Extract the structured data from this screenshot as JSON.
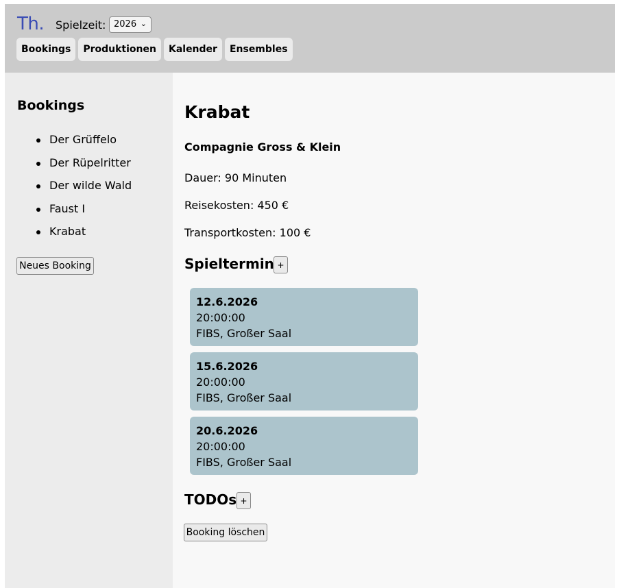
{
  "header": {
    "logo": "Th.",
    "season_label": "Spielzeit:",
    "season_value": "2026",
    "nav": [
      "Bookings",
      "Produktionen",
      "Kalender",
      "Ensembles"
    ]
  },
  "sidebar": {
    "title": "Bookings",
    "items": [
      "Der Grüffelo",
      "Der Rüpelritter",
      "Der wilde Wald",
      "Faust I",
      "Krabat"
    ],
    "new_button": "Neues Booking"
  },
  "main": {
    "title": "Krabat",
    "company": "Compagnie Gross & Klein",
    "duration": "Dauer: 90 Minuten",
    "travel_costs": "Reisekosten: 450 €",
    "transport_costs": "Transportkosten: 100 €",
    "dates_title": "Spieltermine",
    "add_label": "+",
    "dates": [
      {
        "date": "12.6.2026",
        "time": "20:00:00",
        "venue": "FIBS, Großer Saal"
      },
      {
        "date": "15.6.2026",
        "time": "20:00:00",
        "venue": "FIBS, Großer Saal"
      },
      {
        "date": "20.6.2026",
        "time": "20:00:00",
        "venue": "FIBS, Großer Saal"
      }
    ],
    "todos_title": "TODOs",
    "delete_button": "Booking löschen"
  },
  "colors": {
    "logo": "#3a4cb4",
    "header_bg": "#cbcbcb",
    "sidebar_bg": "#ececec",
    "card_bg": "#acc4cc"
  }
}
